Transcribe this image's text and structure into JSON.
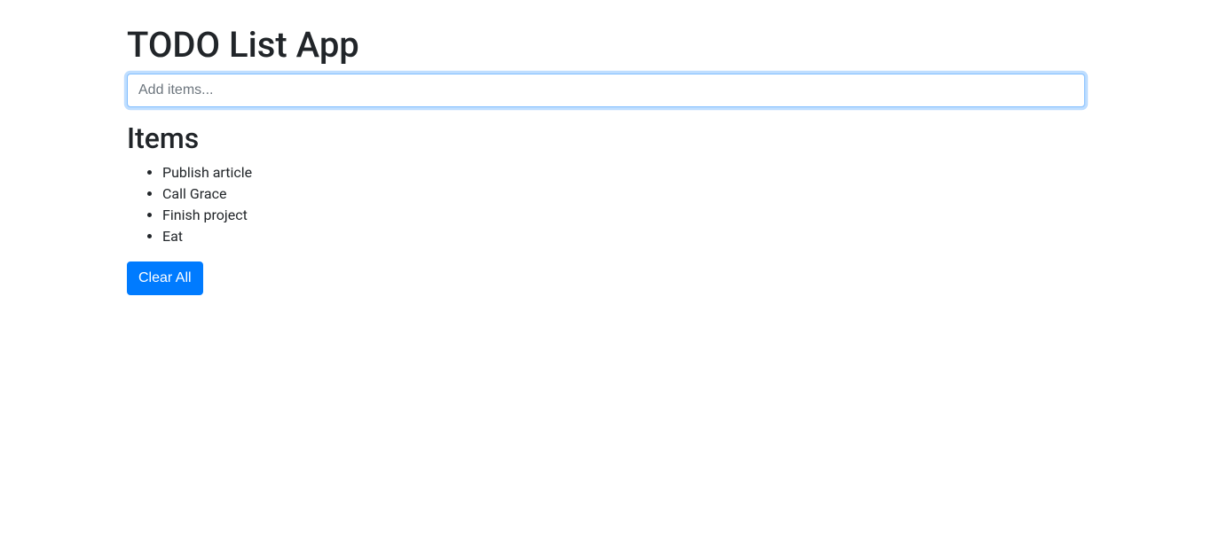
{
  "app": {
    "title": "TODO List App"
  },
  "input": {
    "placeholder": "Add items...",
    "value": ""
  },
  "list": {
    "heading": "Items",
    "items": [
      "Publish article",
      "Call Grace",
      "Finish project",
      "Eat"
    ]
  },
  "buttons": {
    "clear_all": "Clear All"
  }
}
